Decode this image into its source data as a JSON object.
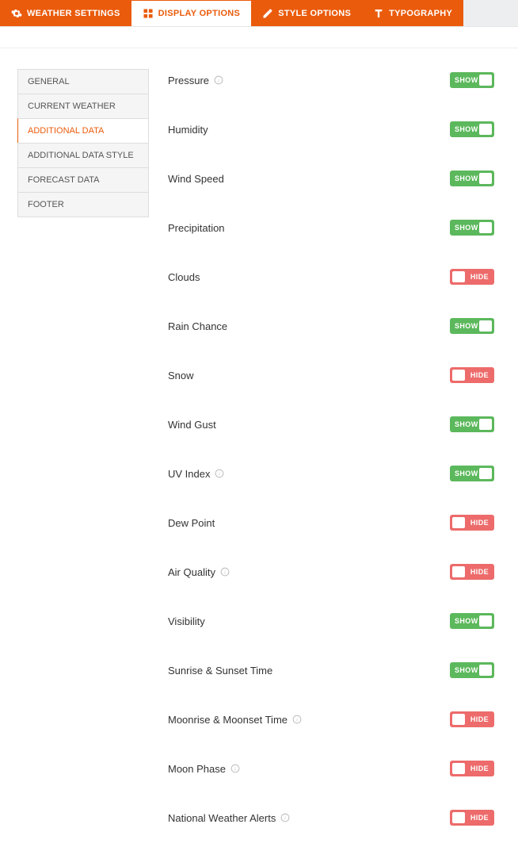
{
  "colors": {
    "accent": "#ea5b0c",
    "show": "#5cb85c",
    "hide": "#ed6b6b"
  },
  "toggle_labels": {
    "show": "SHOW",
    "hide": "HIDE"
  },
  "tabs": [
    {
      "id": "weather-settings",
      "label": "WEATHER SETTINGS",
      "icon": "gear-icon",
      "active": false
    },
    {
      "id": "display-options",
      "label": "DISPLAY OPTIONS",
      "icon": "grid-icon",
      "active": true
    },
    {
      "id": "style-options",
      "label": "STYLE OPTIONS",
      "icon": "pencil-icon",
      "active": false
    },
    {
      "id": "typography",
      "label": "TYPOGRAPHY",
      "icon": "type-icon",
      "active": false
    }
  ],
  "sidebar": {
    "items": [
      {
        "id": "general",
        "label": "GENERAL",
        "active": false
      },
      {
        "id": "current-weather",
        "label": "CURRENT WEATHER",
        "active": false
      },
      {
        "id": "additional-data",
        "label": "ADDITIONAL DATA",
        "active": true
      },
      {
        "id": "additional-data-style",
        "label": "ADDITIONAL DATA STYLE",
        "active": false
      },
      {
        "id": "forecast-data",
        "label": "FORECAST DATA",
        "active": false
      },
      {
        "id": "footer",
        "label": "FOOTER",
        "active": false
      }
    ]
  },
  "settings": [
    {
      "id": "pressure",
      "label": "Pressure",
      "info": true,
      "state": "show"
    },
    {
      "id": "humidity",
      "label": "Humidity",
      "info": false,
      "state": "show"
    },
    {
      "id": "wind-speed",
      "label": "Wind Speed",
      "info": false,
      "state": "show"
    },
    {
      "id": "precipitation",
      "label": "Precipitation",
      "info": false,
      "state": "show"
    },
    {
      "id": "clouds",
      "label": "Clouds",
      "info": false,
      "state": "hide"
    },
    {
      "id": "rain-chance",
      "label": "Rain Chance",
      "info": false,
      "state": "show"
    },
    {
      "id": "snow",
      "label": "Snow",
      "info": false,
      "state": "hide"
    },
    {
      "id": "wind-gust",
      "label": "Wind Gust",
      "info": false,
      "state": "show"
    },
    {
      "id": "uv-index",
      "label": "UV Index",
      "info": true,
      "state": "show"
    },
    {
      "id": "dew-point",
      "label": "Dew Point",
      "info": false,
      "state": "hide"
    },
    {
      "id": "air-quality",
      "label": "Air Quality",
      "info": true,
      "state": "hide"
    },
    {
      "id": "visibility",
      "label": "Visibility",
      "info": false,
      "state": "show"
    },
    {
      "id": "sunrise-sunset",
      "label": "Sunrise & Sunset Time",
      "info": false,
      "state": "show"
    },
    {
      "id": "moonrise-moonset",
      "label": "Moonrise & Moonset Time",
      "info": true,
      "state": "hide"
    },
    {
      "id": "moon-phase",
      "label": "Moon Phase",
      "info": true,
      "state": "hide"
    },
    {
      "id": "nws-alerts",
      "label": "National Weather Alerts",
      "info": true,
      "state": "hide"
    }
  ]
}
